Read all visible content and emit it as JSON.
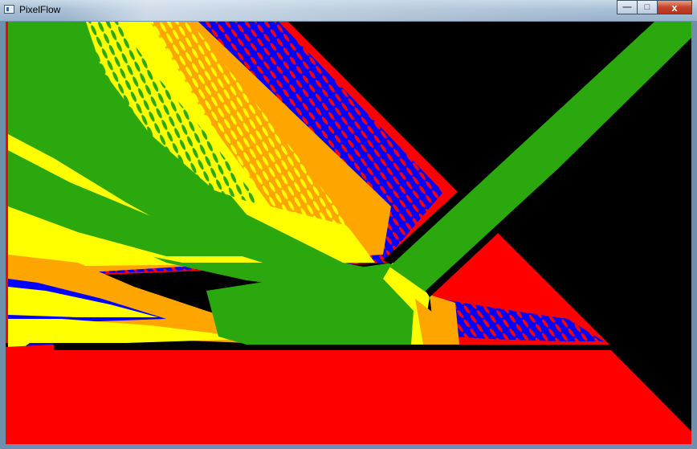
{
  "window": {
    "title": "PixelFlow",
    "controls": {
      "minimize": "—",
      "maximize": "□",
      "close": "x"
    }
  },
  "colors": {
    "background": "#000000",
    "red": "#ff0000",
    "blue": "#0000ff",
    "orange": "#ffa500",
    "yellow": "#ffff00",
    "green": "#2aa80e"
  }
}
